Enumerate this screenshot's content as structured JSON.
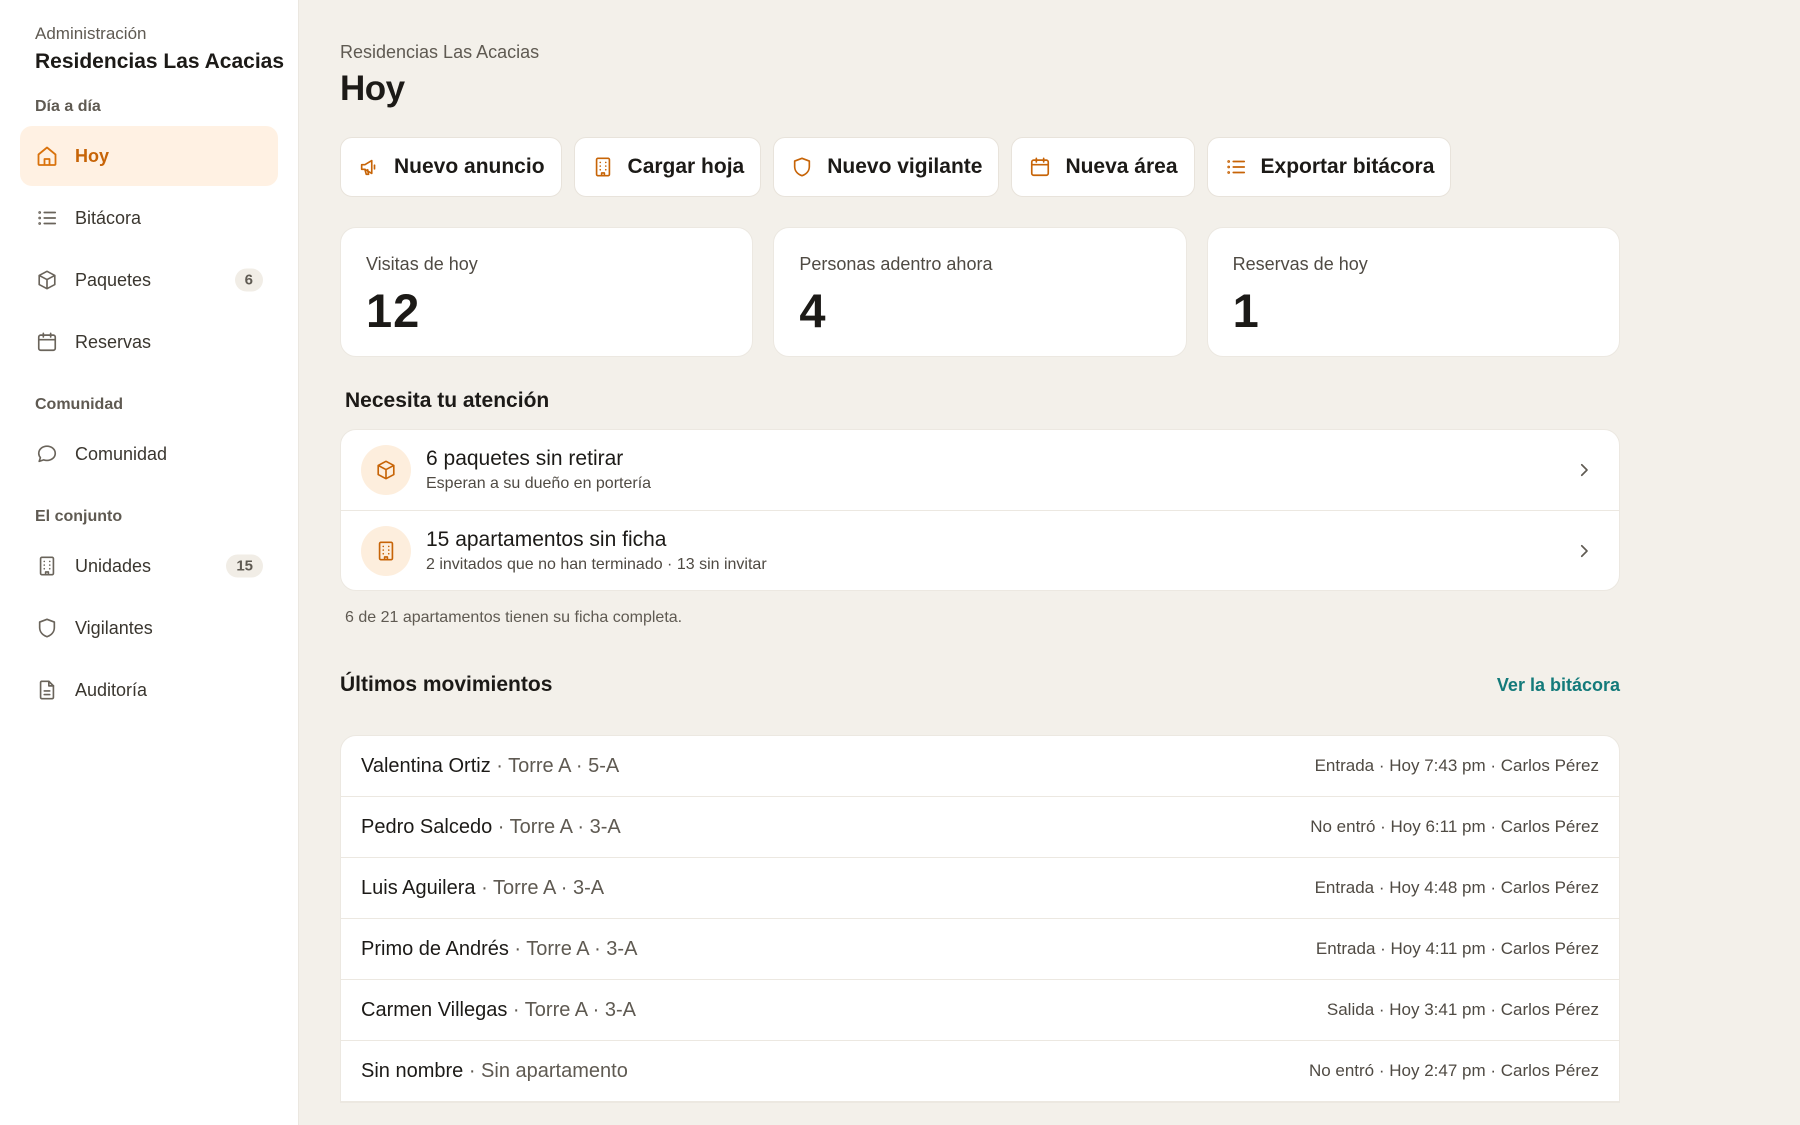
{
  "sidebar": {
    "kicker": "Administración",
    "org_name": "Residencias Las Acacias",
    "sections": [
      {
        "label": "Día a día"
      },
      {
        "label": "Comunidad"
      },
      {
        "label": "El conjunto"
      }
    ],
    "items": [
      {
        "label": "Hoy",
        "icon": "home-icon",
        "active": true
      },
      {
        "label": "Bitácora",
        "icon": "list-icon"
      },
      {
        "label": "Paquetes",
        "icon": "package-icon",
        "badge": "6"
      },
      {
        "label": "Reservas",
        "icon": "calendar-icon"
      },
      {
        "label": "Comunidad",
        "icon": "chat-bubble-icon"
      },
      {
        "label": "Unidades",
        "icon": "building-icon",
        "badge": "15"
      },
      {
        "label": "Vigilantes",
        "icon": "shield-icon"
      },
      {
        "label": "Auditoría",
        "icon": "document-icon"
      }
    ]
  },
  "header": {
    "breadcrumb": "Residencias Las Acacias",
    "title": "Hoy"
  },
  "actions": [
    {
      "label": "Nuevo anuncio",
      "icon": "megaphone-icon"
    },
    {
      "label": "Cargar hoja",
      "icon": "building-icon"
    },
    {
      "label": "Nuevo vigilante",
      "icon": "shield-icon"
    },
    {
      "label": "Nueva área",
      "icon": "calendar-icon"
    },
    {
      "label": "Exportar bitácora",
      "icon": "list-icon"
    }
  ],
  "stats": [
    {
      "label": "Visitas de hoy",
      "value": "12"
    },
    {
      "label": "Personas adentro ahora",
      "value": "4"
    },
    {
      "label": "Reservas de hoy",
      "value": "1"
    }
  ],
  "attention": {
    "title": "Necesita tu atención",
    "items": [
      {
        "title": "6 paquetes sin retirar",
        "subtitle": "Esperan a su dueño en portería",
        "icon": "package-icon"
      },
      {
        "title": "15 apartamentos sin ficha",
        "subtitle": "2 invitados que no han terminado · 13 sin invitar",
        "icon": "building-icon"
      }
    ],
    "note": "6 de 21 apartamentos tienen su ficha completa."
  },
  "movements": {
    "title": "Últimos movimientos",
    "link": "Ver la bitácora",
    "rows": [
      {
        "name": "Valentina Ortiz",
        "location": " · Torre A · 5-A",
        "detail": "Entrada · Hoy 7:43 pm · Carlos Pérez"
      },
      {
        "name": "Pedro Salcedo",
        "location": " · Torre A · 3-A",
        "detail": "No entró · Hoy 6:11 pm · Carlos Pérez"
      },
      {
        "name": "Luis Aguilera",
        "location": " · Torre A · 3-A",
        "detail": "Entrada · Hoy 4:48 pm · Carlos Pérez"
      },
      {
        "name": "Primo de Andrés",
        "location": " · Torre A · 3-A",
        "detail": "Entrada · Hoy 4:11 pm · Carlos Pérez"
      },
      {
        "name": "Carmen Villegas",
        "location": " · Torre A · 3-A",
        "detail": "Salida · Hoy 3:41 pm · Carlos Pérez"
      },
      {
        "name": "Sin nombre",
        "location": " · Sin apartamento",
        "detail": "No entró · Hoy 2:47 pm · Carlos Pérez"
      }
    ]
  },
  "colors": {
    "accent": "#d9720c",
    "accent_bg": "#fff1e3",
    "link": "#137a7a",
    "page_bg": "#f3f0ea"
  }
}
